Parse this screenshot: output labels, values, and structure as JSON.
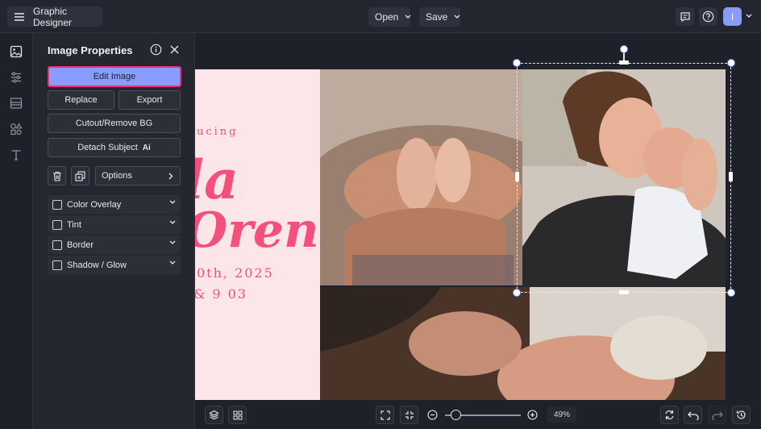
{
  "header": {
    "app_title": "Graphic Designer",
    "open_label": "Open",
    "save_label": "Save",
    "avatar_initial": "I"
  },
  "rail": {
    "icons": [
      "image-icon",
      "sliders-icon",
      "layout-icon",
      "shapes-icon",
      "text-icon"
    ]
  },
  "panel": {
    "title": "Image Properties",
    "edit_image": "Edit Image",
    "replace": "Replace",
    "export": "Export",
    "cutout": "Cutout/Remove BG",
    "detach_subject": "Detach Subject",
    "ai_badge": "Ai",
    "options": "Options",
    "accordions": [
      {
        "label": "Color Overlay"
      },
      {
        "label": "Tint"
      },
      {
        "label": "Border"
      },
      {
        "label": "Shadow / Glow"
      }
    ]
  },
  "canvas": {
    "intro_text": "ucing",
    "name_line1": "la",
    "name_line2": "Oren",
    "date_line": "0th, 2025",
    "weight_line": "& 9 03",
    "colors": {
      "pink_panel": "#fde6e7",
      "accent_pink": "#f4507e"
    }
  },
  "footer": {
    "zoom": "49%"
  }
}
